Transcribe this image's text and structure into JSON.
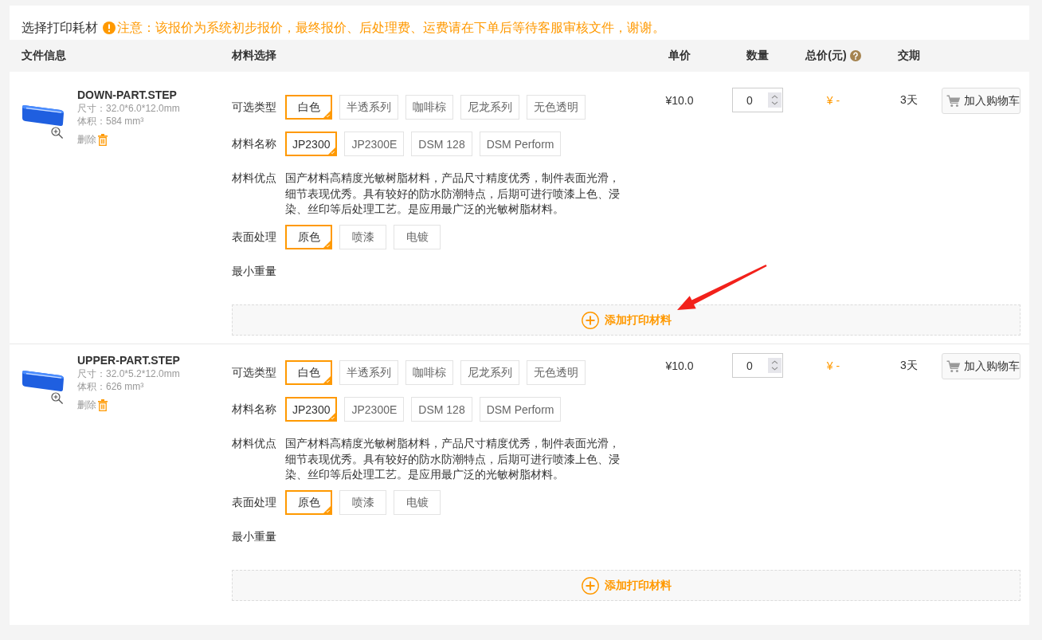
{
  "header": {
    "title": "选择打印耗材",
    "notice": "注意：该报价为系统初步报价，最终报价、后处理费、运费请在下单后等待客服审核文件，谢谢。"
  },
  "columns": [
    {
      "label": "文件信息",
      "kind": "plain"
    },
    {
      "label": "材料选择",
      "kind": "plain"
    },
    {
      "label": "单价",
      "kind": "plain"
    },
    {
      "label": "数量",
      "kind": "plain"
    },
    {
      "label": "总价(元)",
      "kind": "help"
    },
    {
      "label": "交期",
      "kind": "plain"
    }
  ],
  "files": [
    {
      "name": "DOWN-PART.STEP",
      "size": "尺寸：32.0*6.0*12.0mm",
      "volume": "体积：584 mm³",
      "delete_label": "删除",
      "options": [
        {
          "label": "可选类型",
          "kind": "choices",
          "choices": [
            {
              "label": "白色",
              "selected": true
            },
            {
              "label": "半透系列",
              "selected": false
            },
            {
              "label": "咖啡棕",
              "selected": false
            },
            {
              "label": "尼龙系列",
              "selected": false
            },
            {
              "label": "无色透明",
              "selected": false
            }
          ]
        },
        {
          "label": "材料名称",
          "kind": "choices",
          "choices": [
            {
              "label": "JP2300",
              "selected": true
            },
            {
              "label": "JP2300E",
              "selected": false
            },
            {
              "label": "DSM 128",
              "selected": false
            },
            {
              "label": "DSM Perform",
              "selected": false
            }
          ]
        },
        {
          "label": "材料优点",
          "kind": "text",
          "text": "国产材料高精度光敏树脂材料，产品尺寸精度优秀，制件表面光滑，细节表现优秀。具有较好的防水防潮特点，后期可进行喷漆上色、浸染、丝印等后处理工艺。是应用最广泛的光敏树脂材料。"
        },
        {
          "label": "表面处理",
          "kind": "choices",
          "choices": [
            {
              "label": "原色",
              "selected": true
            },
            {
              "label": "喷漆",
              "selected": false
            },
            {
              "label": "电镀",
              "selected": false
            }
          ]
        },
        {
          "label": "最小重量",
          "kind": "label"
        }
      ],
      "unit_price": "¥10.0",
      "quantity": "0",
      "total": "¥ -",
      "delivery": "3天",
      "cart_button": "加入购物车",
      "add_material": "添加打印材料"
    },
    {
      "name": "UPPER-PART.STEP",
      "size": "尺寸：32.0*5.2*12.0mm",
      "volume": "体积：626 mm³",
      "delete_label": "删除",
      "options": [
        {
          "label": "可选类型",
          "kind": "choices",
          "choices": [
            {
              "label": "白色",
              "selected": true
            },
            {
              "label": "半透系列",
              "selected": false
            },
            {
              "label": "咖啡棕",
              "selected": false
            },
            {
              "label": "尼龙系列",
              "selected": false
            },
            {
              "label": "无色透明",
              "selected": false
            }
          ]
        },
        {
          "label": "材料名称",
          "kind": "choices",
          "choices": [
            {
              "label": "JP2300",
              "selected": true
            },
            {
              "label": "JP2300E",
              "selected": false
            },
            {
              "label": "DSM 128",
              "selected": false
            },
            {
              "label": "DSM Perform",
              "selected": false
            }
          ]
        },
        {
          "label": "材料优点",
          "kind": "text",
          "text": "国产材料高精度光敏树脂材料，产品尺寸精度优秀，制件表面光滑，细节表现优秀。具有较好的防水防潮特点，后期可进行喷漆上色、浸染、丝印等后处理工艺。是应用最广泛的光敏树脂材料。"
        },
        {
          "label": "表面处理",
          "kind": "choices",
          "choices": [
            {
              "label": "原色",
              "selected": true
            },
            {
              "label": "喷漆",
              "selected": false
            },
            {
              "label": "电镀",
              "selected": false
            }
          ]
        },
        {
          "label": "最小重量",
          "kind": "label"
        }
      ],
      "unit_price": "¥10.0",
      "quantity": "0",
      "total": "¥ -",
      "delivery": "3天",
      "cart_button": "加入购物车",
      "add_material": "添加打印材料"
    }
  ]
}
